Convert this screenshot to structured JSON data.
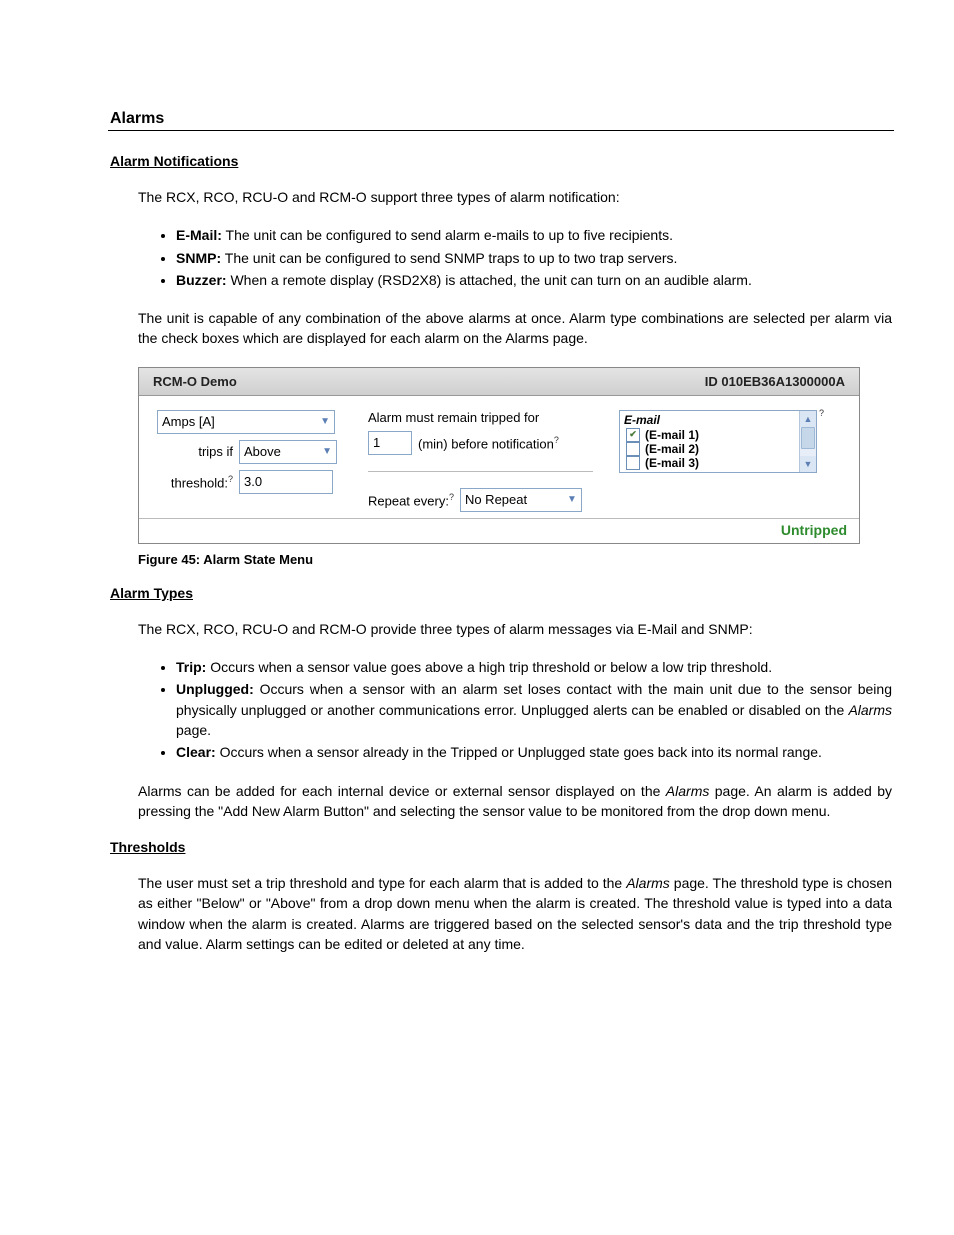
{
  "h1": "Alarms",
  "sec1": {
    "title": "Alarm Notifications",
    "intro": "The RCX, RCO, RCU-O and RCM-O support three types of alarm notification:",
    "items": [
      {
        "b": "E-Mail:",
        "t": " The unit can be configured to send alarm e-mails to up to five recipients."
      },
      {
        "b": "SNMP:",
        "t": " The unit can be configured to send SNMP traps to up to two trap servers."
      },
      {
        "b": "Buzzer:",
        "t": " When a remote display (RSD2X8) is attached, the unit can turn on an audible alarm."
      }
    ],
    "outro": "The unit is capable of any combination of the above alarms at once.  Alarm type combinations are selected per alarm via the check boxes which are displayed for each alarm on the Alarms page."
  },
  "panel": {
    "title": "RCM-O Demo",
    "id": "ID 010EB36A1300000A",
    "sensor": "Amps [A]",
    "trips_if": "trips if",
    "direction": "Above",
    "threshold_lbl": "threshold:",
    "threshold_val": "3.0",
    "remain1": "Alarm must remain tripped for",
    "remain_val": "1",
    "remain2": "(min) before notification",
    "repeat_lbl": "Repeat every:",
    "repeat_val": "No Repeat",
    "email_head": "E-mail",
    "emails": [
      {
        "label": "(E-mail 1)",
        "checked": true
      },
      {
        "label": "(E-mail 2)",
        "checked": false
      },
      {
        "label": "(E-mail 3)",
        "checked": false
      }
    ],
    "status": "Untripped"
  },
  "caption": "Figure 45: Alarm State Menu",
  "sec2": {
    "title": "Alarm Types",
    "intro": "The RCX, RCO, RCU-O and RCM-O provide three types of alarm messages via E-Mail and SNMP:",
    "items": [
      {
        "b": "Trip:",
        "t": " Occurs when a sensor value goes above a high trip threshold or below a low trip threshold."
      },
      {
        "b": "Unplugged:",
        "t": "  Occurs when a sensor with an alarm set loses contact with the main unit due to the sensor being physically unplugged or another communications error.  Unplugged alerts can be enabled or disabled on the ",
        "i": "Alarms",
        "t2": " page."
      },
      {
        "b": "Clear:",
        "t": " Occurs when a sensor already in the Tripped or Unplugged state goes back into its normal range."
      }
    ],
    "outro1": "Alarms can be added for each internal device or external sensor displayed on the ",
    "outro1i": "Alarms",
    "outro2": " page. An alarm is added by pressing the \"Add New Alarm Button\" and selecting the sensor value to be monitored from the drop down menu."
  },
  "sec3": {
    "title": "Thresholds",
    "p1a": "The user must set a trip threshold and type for each alarm that is added to the ",
    "p1i": "Alarms",
    "p1b": " page. The threshold type is chosen as either \"Below\" or \"Above\" from a drop down menu when the alarm is created. The threshold value is typed into a data window when the alarm is created. Alarms are triggered based on the selected sensor's data and the trip threshold type and value. Alarm settings can be edited or deleted at any time."
  }
}
